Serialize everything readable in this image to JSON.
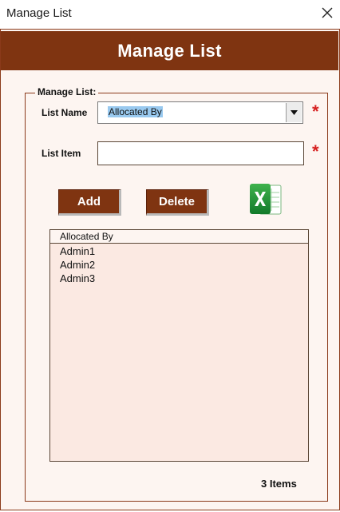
{
  "window": {
    "title": "Manage List",
    "close_icon": "close-icon"
  },
  "header": {
    "title": "Manage List"
  },
  "form": {
    "group_label": "Manage List:",
    "list_name_label": "List Name",
    "list_name_value": "Allocated By",
    "list_item_label": "List Item",
    "list_item_value": "",
    "required_marker": "*",
    "add_label": "Add",
    "delete_label": "Delete",
    "export_icon": "excel-icon"
  },
  "list": {
    "header": "Allocated By",
    "items": [
      "Admin1",
      "Admin2",
      "Admin3"
    ]
  },
  "status": {
    "count_text": "3 Items"
  },
  "colors": {
    "accent": "#7f3411",
    "panel_bg": "#fdf5f1",
    "list_bg": "#fbe9e2",
    "required": "#d61f1f",
    "selection": "#99c9ef"
  }
}
